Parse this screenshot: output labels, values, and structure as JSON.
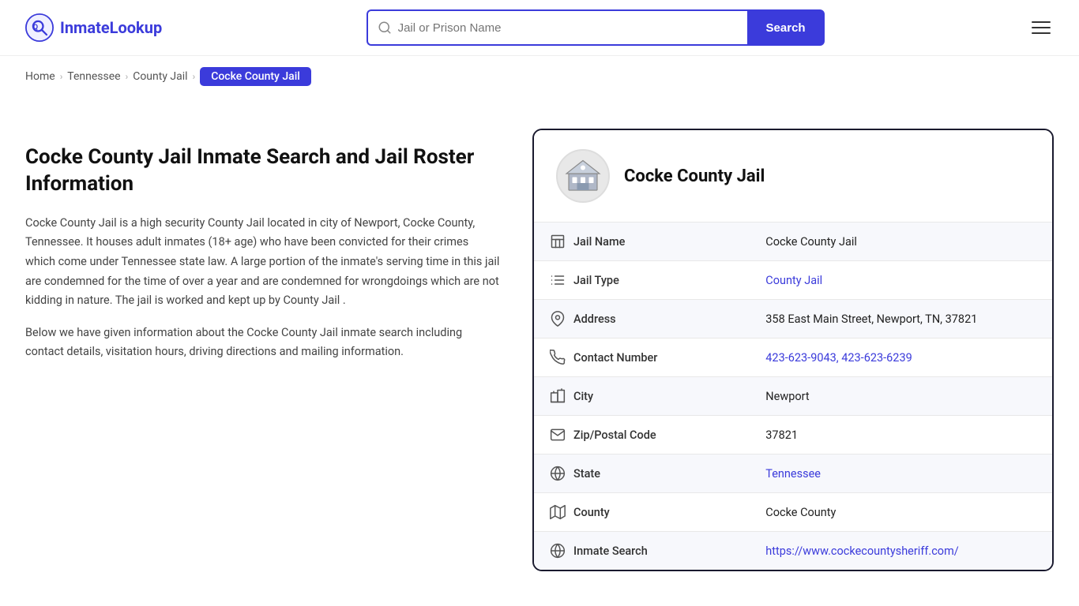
{
  "site": {
    "logo_text": "InmateLookup",
    "logo_icon": "search"
  },
  "header": {
    "search_placeholder": "Jail or Prison Name",
    "search_button": "Search",
    "search_value": ""
  },
  "breadcrumb": {
    "items": [
      {
        "label": "Home",
        "href": "#"
      },
      {
        "label": "Tennessee",
        "href": "#"
      },
      {
        "label": "County Jail",
        "href": "#"
      },
      {
        "label": "Cocke County Jail",
        "current": true
      }
    ]
  },
  "left": {
    "heading": "Cocke County Jail Inmate Search and Jail Roster Information",
    "paragraph1": "Cocke County Jail is a high security County Jail located in city of Newport, Cocke County, Tennessee. It houses adult inmates (18+ age) who have been convicted for their crimes which come under Tennessee state law. A large portion of the inmate's serving time in this jail are condemned for the time of over a year and are condemned for wrongdoings which are not kidding in nature. The jail is worked and kept up by County Jail .",
    "paragraph2": "Below we have given information about the Cocke County Jail inmate search including contact details, visitation hours, driving directions and mailing information."
  },
  "card": {
    "title": "Cocke County Jail",
    "rows": [
      {
        "icon": "building",
        "label": "Jail Name",
        "value": "Cocke County Jail",
        "link": false
      },
      {
        "icon": "list",
        "label": "Jail Type",
        "value": "County Jail",
        "link": true,
        "href": "#"
      },
      {
        "icon": "location",
        "label": "Address",
        "value": "358 East Main Street, Newport, TN, 37821",
        "link": false
      },
      {
        "icon": "phone",
        "label": "Contact Number",
        "value": "423-623-9043, 423-623-6239",
        "link": true,
        "href": "tel:4236239043"
      },
      {
        "icon": "city",
        "label": "City",
        "value": "Newport",
        "link": false
      },
      {
        "icon": "mail",
        "label": "Zip/Postal Code",
        "value": "37821",
        "link": false
      },
      {
        "icon": "globe",
        "label": "State",
        "value": "Tennessee",
        "link": true,
        "href": "#"
      },
      {
        "icon": "map",
        "label": "County",
        "value": "Cocke County",
        "link": false
      },
      {
        "icon": "globe2",
        "label": "Inmate Search",
        "value": "https://www.cockecountysheriff.com/",
        "link": true,
        "href": "https://www.cockecountysheriff.com/"
      }
    ]
  }
}
